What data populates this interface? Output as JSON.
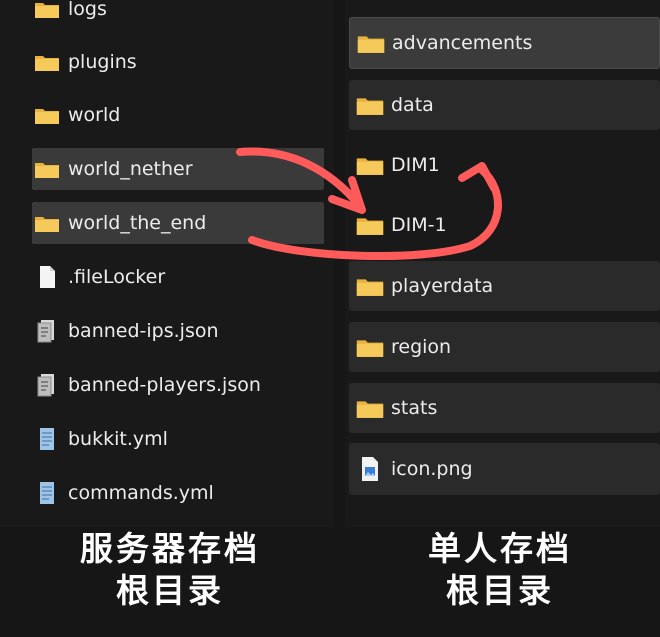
{
  "left_list": [
    {
      "label": "logs",
      "icon": "folder-icon"
    },
    {
      "label": "plugins",
      "icon": "folder-icon"
    },
    {
      "label": "world",
      "icon": "folder-icon"
    },
    {
      "label": "world_nether",
      "icon": "folder-icon"
    },
    {
      "label": "world_the_end",
      "icon": "folder-icon"
    },
    {
      "label": ".fileLocker",
      "icon": "file-icon"
    },
    {
      "label": "banned-ips.json",
      "icon": "json-file-icon"
    },
    {
      "label": "banned-players.json",
      "icon": "json-file-icon"
    },
    {
      "label": "bukkit.yml",
      "icon": "yml-file-icon"
    },
    {
      "label": "commands.yml",
      "icon": "yml-file-icon"
    }
  ],
  "right_list": [
    {
      "label": "advancements",
      "icon": "folder-icon"
    },
    {
      "label": "data",
      "icon": "folder-icon"
    },
    {
      "label": "DIM1",
      "icon": "folder-icon"
    },
    {
      "label": "DIM-1",
      "icon": "folder-icon"
    },
    {
      "label": "playerdata",
      "icon": "folder-icon"
    },
    {
      "label": "region",
      "icon": "folder-icon"
    },
    {
      "label": "stats",
      "icon": "folder-icon"
    },
    {
      "label": "icon.png",
      "icon": "image-file-icon"
    }
  ],
  "captions": {
    "left_line1": "服务器存档",
    "left_line2": "根目录",
    "right_line1": "单人存档",
    "right_line2": "根目录"
  },
  "colors": {
    "folder": "#f2c14e",
    "arrow": "#ff5b5b",
    "selection": "#3a3a3a"
  }
}
